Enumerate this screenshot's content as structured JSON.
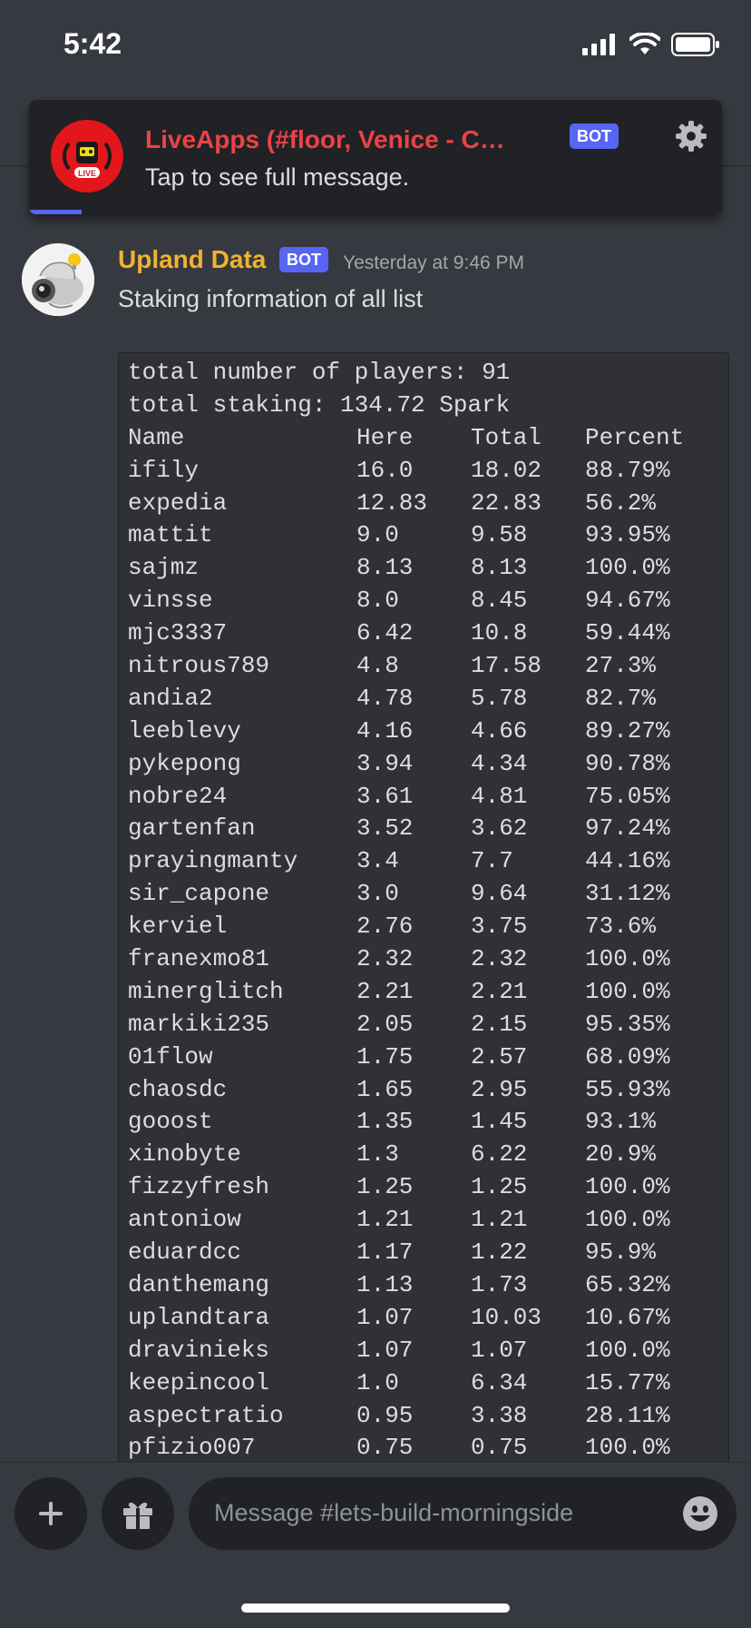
{
  "status_bar": {
    "time": "5:42"
  },
  "notification": {
    "title": "LiveApps (#floor, Venice - Com...",
    "badge": "BOT",
    "subtitle": "Tap to see full message.",
    "avatar_text": "LIVE",
    "colors": {
      "title": "#ed4245",
      "avatar": "#e3161c"
    }
  },
  "message": {
    "author": "Upland Data",
    "badge": "BOT",
    "timestamp": "Yesterday at 9:46 PM",
    "text": "Staking information of all list",
    "colors": {
      "author": "#f0b232",
      "badge": "#5865f2"
    }
  },
  "code": {
    "line1": "total number of players: 91",
    "line2": "total staking: 134.72 Spark",
    "headers": [
      "Name",
      "Here",
      "Total",
      "Percent"
    ],
    "rows": [
      [
        "ifily",
        "16.0",
        "18.02",
        "88.79%"
      ],
      [
        "expedia",
        "12.83",
        "22.83",
        "56.2%"
      ],
      [
        "mattit",
        "9.0",
        "9.58",
        "93.95%"
      ],
      [
        "sajmz",
        "8.13",
        "8.13",
        "100.0%"
      ],
      [
        "vinsse",
        "8.0",
        "8.45",
        "94.67%"
      ],
      [
        "mjc3337",
        "6.42",
        "10.8",
        "59.44%"
      ],
      [
        "nitrous789",
        "4.8",
        "17.58",
        "27.3%"
      ],
      [
        "andia2",
        "4.78",
        "5.78",
        "82.7%"
      ],
      [
        "leeblevy",
        "4.16",
        "4.66",
        "89.27%"
      ],
      [
        "pykepong",
        "3.94",
        "4.34",
        "90.78%"
      ],
      [
        "nobre24",
        "3.61",
        "4.81",
        "75.05%"
      ],
      [
        "gartenfan",
        "3.52",
        "3.62",
        "97.24%"
      ],
      [
        "prayingmanty",
        "3.4",
        "7.7",
        "44.16%"
      ],
      [
        "sir_capone",
        "3.0",
        "9.64",
        "31.12%"
      ],
      [
        "kerviel",
        "2.76",
        "3.75",
        "73.6%"
      ],
      [
        "franexmo81",
        "2.32",
        "2.32",
        "100.0%"
      ],
      [
        "minerglitch",
        "2.21",
        "2.21",
        "100.0%"
      ],
      [
        "markiki235",
        "2.05",
        "2.15",
        "95.35%"
      ],
      [
        "01flow",
        "1.75",
        "2.57",
        "68.09%"
      ],
      [
        "chaosdc",
        "1.65",
        "2.95",
        "55.93%"
      ],
      [
        "gooost",
        "1.35",
        "1.45",
        "93.1%"
      ],
      [
        "xinobyte",
        "1.3",
        "6.22",
        "20.9%"
      ],
      [
        "fizzyfresh",
        "1.25",
        "1.25",
        "100.0%"
      ],
      [
        "antoniow",
        "1.21",
        "1.21",
        "100.0%"
      ],
      [
        "eduardcc",
        "1.17",
        "1.22",
        "95.9%"
      ],
      [
        "danthemang",
        "1.13",
        "1.73",
        "65.32%"
      ],
      [
        "uplandtara",
        "1.07",
        "10.03",
        "10.67%"
      ],
      [
        "dravinieks",
        "1.07",
        "1.07",
        "100.0%"
      ],
      [
        "keepincool",
        "1.0",
        "6.34",
        "15.77%"
      ],
      [
        "aspectratio",
        "0.95",
        "3.38",
        "28.11%"
      ],
      [
        "pfizio007",
        "0.75",
        "0.75",
        "100.0%"
      ]
    ]
  },
  "composer": {
    "placeholder": "Message #lets-build-morningside",
    "icons": [
      "plus-icon",
      "gift-icon",
      "emoji-icon"
    ]
  }
}
